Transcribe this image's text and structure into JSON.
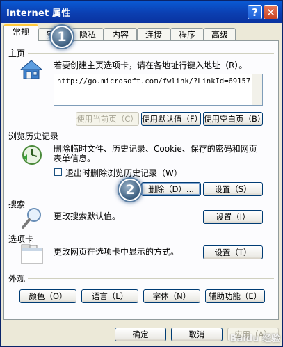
{
  "window": {
    "title": "Internet 属性",
    "help_button": "?",
    "close_button": "✕"
  },
  "tabs": [
    "常规",
    "安全",
    "隐私",
    "内容",
    "连接",
    "程序",
    "高级"
  ],
  "homepage": {
    "section_label": "主页",
    "instruction": "若要创建主页选项卡，请在各地址行键入地址（R）。",
    "url": "http://go.microsoft.com/fwlink/?LinkId=69157",
    "use_current_button": "使用当前页（C）",
    "use_default_button": "使用默认值（F）",
    "use_blank_button": "使用空白页（B）"
  },
  "history": {
    "section_label": "浏览历史记录",
    "description_line1": "删除临时文件、历史记录、Cookie、保存的密码和网页",
    "description_line2": "表单信息。",
    "checkbox_label": "退出时删除浏览历史记录（W）",
    "delete_button": "删除（D）...",
    "settings_button": "设置（S）"
  },
  "search": {
    "section_label": "搜索",
    "description": "更改搜索默认值。",
    "settings_button": "设置（I）"
  },
  "tabsection": {
    "section_label": "选项卡",
    "description": "更改网页在选项卡中显示的方式。",
    "settings_button": "设置（T）"
  },
  "appearance": {
    "section_label": "外观",
    "colors_button": "颜色（O）",
    "languages_button": "语言（L）",
    "fonts_button": "字体（N）",
    "accessibility_button": "辅助功能（E）"
  },
  "footer": {
    "ok_button": "确定",
    "cancel_button": "取消",
    "apply_button": "应用（A）"
  },
  "callouts": {
    "step1": "1",
    "step2": "2"
  },
  "watermark": "Baidu 经验",
  "colors": {
    "titlebar": "#0b3fb1",
    "dialog_bg": "#ece9d8",
    "panel_bg": "#fcfcfe",
    "active_tab_accent": "#ffc83c",
    "callout": "#3d5f80"
  }
}
